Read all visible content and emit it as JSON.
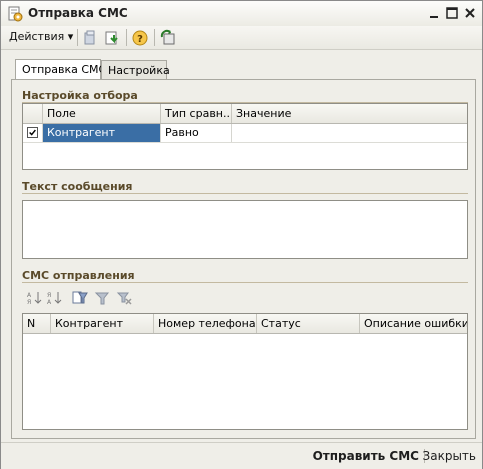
{
  "window": {
    "title": "Отправка СМС",
    "title_icon": "document-settings-icon"
  },
  "toolbar": {
    "actions_label": "Действия",
    "icons": [
      "move-to-folder-icon",
      "export-down-icon",
      "help-icon",
      "refresh-icon"
    ]
  },
  "tabs": [
    {
      "label": "Отправка СМС",
      "active": true
    },
    {
      "label": "Настройка",
      "active": false
    }
  ],
  "filter_section": {
    "title": "Настройка отбора",
    "columns": [
      "Поле",
      "Тип сравн...",
      "Значение"
    ],
    "rows": [
      {
        "checked": true,
        "field": "Контрагент",
        "comparison": "Равно",
        "value": ""
      }
    ]
  },
  "message_section": {
    "title": "Текст сообщения",
    "text": ""
  },
  "sms_section": {
    "title": "СМС отправления",
    "tools": [
      "sort-ascending-icon",
      "sort-descending-icon",
      "filter-settings-icon",
      "filter-icon",
      "clear-filter-icon"
    ],
    "columns": [
      "N",
      "Контрагент",
      "Номер телефона",
      "Статус",
      "Описание ошибки"
    ]
  },
  "footer": {
    "send_label": "Отправить СМС",
    "close_label": "Закрыть"
  },
  "colors": {
    "section_title": "#5a4a2a",
    "selection": "#3a6ea5",
    "window_bg": "#efeee8"
  }
}
